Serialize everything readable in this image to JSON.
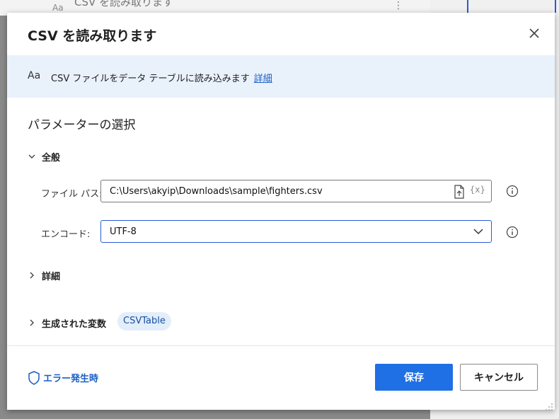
{
  "background": {
    "action_title": "CSV を読み取ります",
    "aa_label": "Aa",
    "more_icon": "vertical-dots-icon"
  },
  "dialog": {
    "title": "CSV を読み取ります",
    "close_icon": "close-icon"
  },
  "info": {
    "icon_text": "Aa",
    "description": "CSV ファイルをデータ テーブルに読み込みます",
    "link": "詳細"
  },
  "parameters": {
    "section_title": "パラメーターの選択",
    "general_group": "全般",
    "file_path_label": "ファイル パス:",
    "file_path_value": "C:\\Users\\akyip\\Downloads\\sample\\fighters.csv",
    "var_icon_text": "{x}",
    "encoding_label": "エンコード:",
    "encoding_value": "UTF-8",
    "advanced_group": "詳細"
  },
  "variables": {
    "group_label": "生成された変数",
    "variable_name": "CSVTable"
  },
  "footer": {
    "on_error": "エラー発生時",
    "save": "保存",
    "cancel": "キャンセル"
  },
  "colors": {
    "accent": "#1f6fe5",
    "banner": "#e9f1fb",
    "link": "#1a5fc4"
  }
}
